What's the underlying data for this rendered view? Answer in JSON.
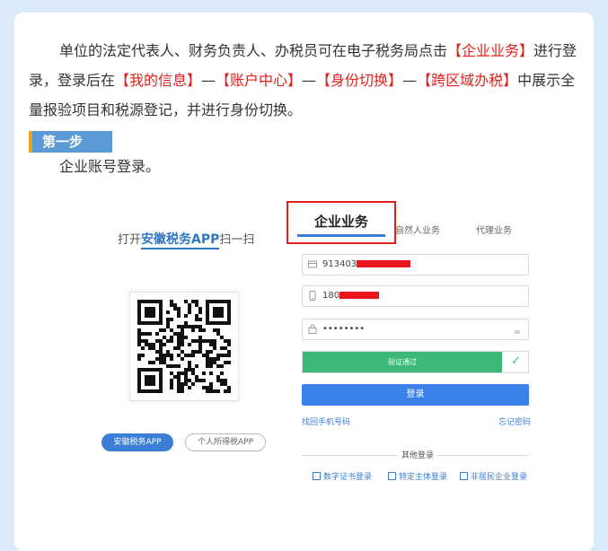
{
  "paragraph": {
    "part1": "单位的法定代表人、财务负责人、办税员可在电子税务局点击",
    "hl1": "【企业业务】",
    "part2": "进行登录，登录后在",
    "hl2": "【我的信息】",
    "sep1": "—",
    "hl3": "【账户中心】",
    "sep2": "—",
    "hl4": "【身份切换】",
    "sep3": "—",
    "hl5": "【跨区域办税】",
    "part3": "中展示全量报验项目和税源登记，并进行身份切换。"
  },
  "step": {
    "badge": "第一步",
    "text": "企业账号登录。"
  },
  "colors": {
    "highlight": "#e0201b",
    "accent": "#3a7fd5",
    "badge_bg": "#5b9bd5",
    "success": "#3cb878"
  },
  "login": {
    "scan_prefix": "打开",
    "scan_app": "安徽税务APP",
    "scan_suffix": "扫一扫",
    "tabs": {
      "active": "企业业务",
      "natural": "自然人业务",
      "agent": "代理业务"
    },
    "taxpayer_id_prefix": "913403",
    "phone_prefix": "180",
    "password_mask": "••••••••",
    "verify_text": "验证通过",
    "login_label": "登录",
    "link_phone": "找回手机号码",
    "link_password": "忘记密码",
    "other_login": "其他登录",
    "methods": [
      "数字证书登录",
      "特定主体登录",
      "非居民企业登录"
    ],
    "app_buttons": [
      "安徽税务APP",
      "个人所得税APP"
    ],
    "icons": [
      "card-icon",
      "phone-icon",
      "lock-icon",
      "eye-icon",
      "check-icon",
      "qr-code-icon"
    ]
  }
}
